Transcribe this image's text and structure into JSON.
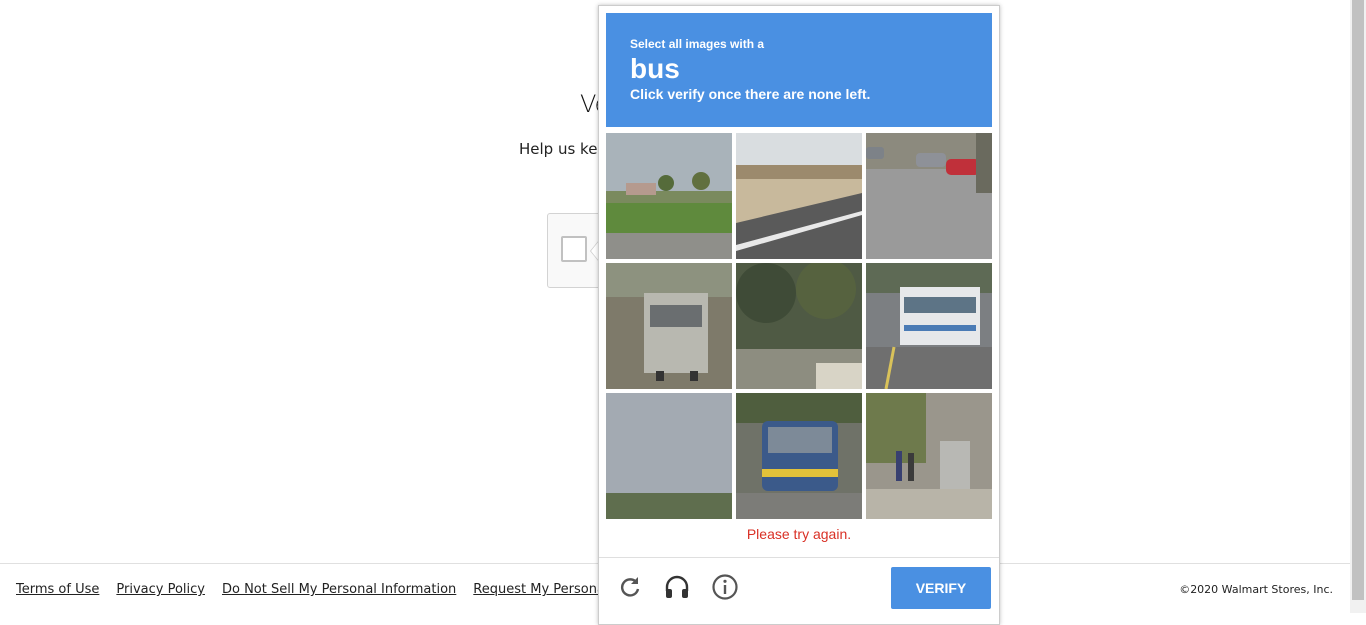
{
  "page": {
    "title": "Ve",
    "subtitle": "Help us kee"
  },
  "footer": {
    "links": [
      "Terms of Use",
      "Privacy Policy",
      "Do Not Sell My Personal Information",
      "Request My Personal In"
    ],
    "copyright": "©2020 Walmart Stores, Inc."
  },
  "captcha": {
    "instruction_small": "Select all images with a",
    "target": "bus",
    "instruction_sub": "Click verify once there are none left.",
    "error": "Please try again.",
    "verify_label": "VERIFY",
    "icons": [
      "reload-icon",
      "headphones-icon",
      "info-icon"
    ],
    "accent": "#4a90e2",
    "error_color": "#d93025"
  }
}
